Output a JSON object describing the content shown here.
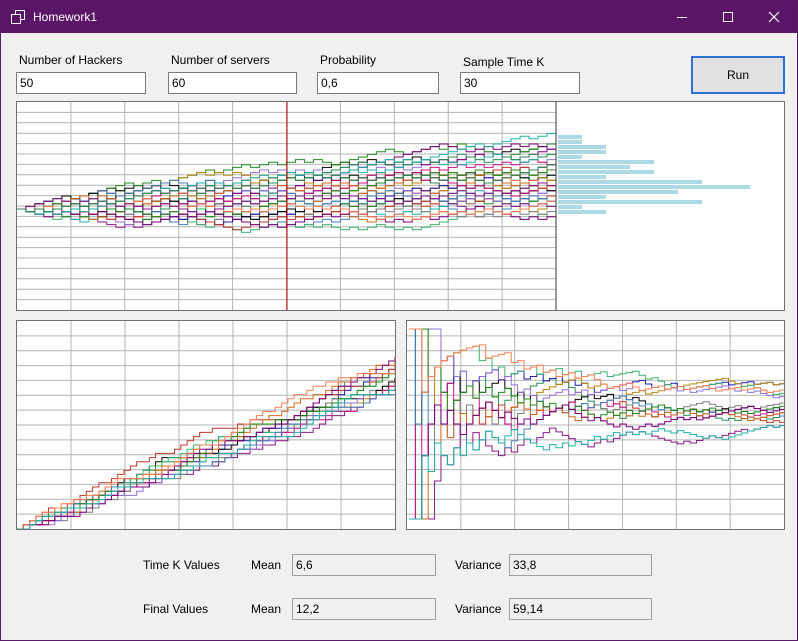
{
  "window": {
    "title": "Homework1"
  },
  "params": {
    "hackers_label": "Number of Hackers",
    "hackers_value": "50",
    "servers_label": "Number of servers",
    "servers_value": "60",
    "prob_label": "Probability",
    "prob_value": "0,6",
    "sample_label": "Sample Time K",
    "sample_value": "30",
    "run_label": "Run"
  },
  "stats": {
    "timek_label": "Time K Values",
    "final_label": "Final Values",
    "mean_label": "Mean",
    "variance_label": "Variance",
    "timek_mean": "6,6",
    "timek_variance": "33,8",
    "final_mean": "12,2",
    "final_variance": "59,14"
  },
  "colors": {
    "titlebar": "#5b1566",
    "series": [
      "#8b1a8b",
      "#2e8b57",
      "#1f1fb4",
      "#c0392b",
      "#7f7f7f",
      "#b8860b",
      "#000000",
      "#3cb371",
      "#9370db",
      "#c71585",
      "#4682b4",
      "#d2691e",
      "#228b22",
      "#800080",
      "#ff7f50",
      "#20b2aa"
    ],
    "histogram": "#add8e6",
    "vertical_marker": "#c00000"
  },
  "charts": [
    {
      "name": "hacker-random-walk-chart",
      "type": "line",
      "description": ""
    },
    {
      "name": "relative-frequency-chart",
      "type": "line"
    },
    {
      "name": "normalized-frequency-chart",
      "type": "line"
    }
  ]
}
